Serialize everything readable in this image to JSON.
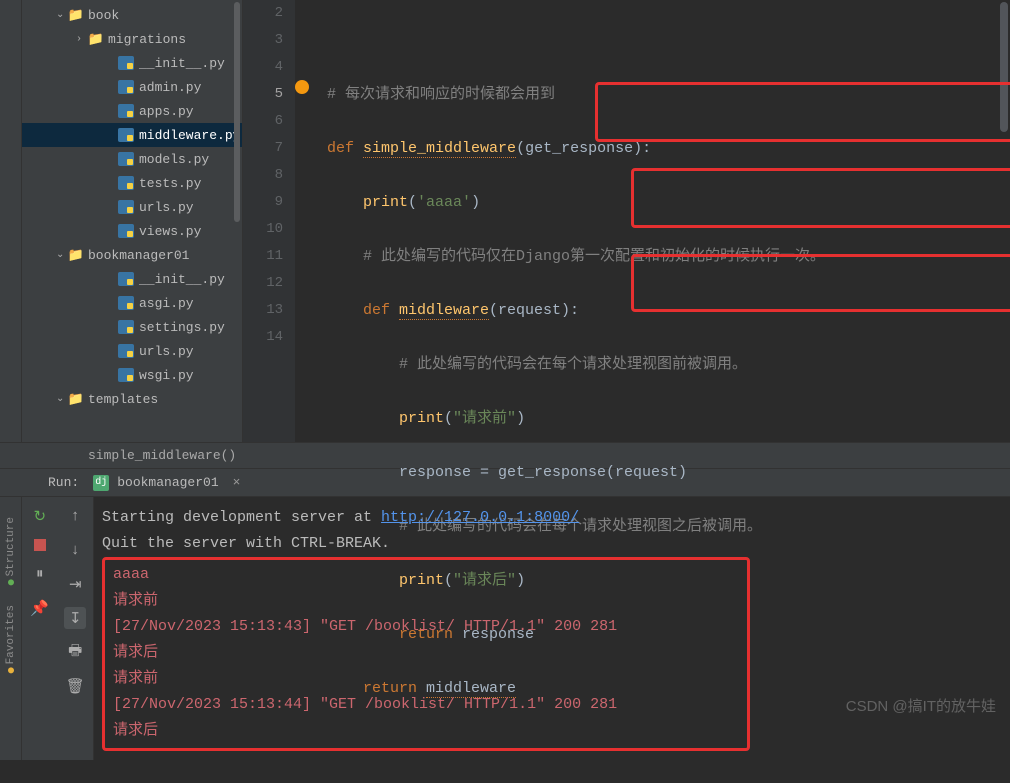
{
  "tree": {
    "items": [
      {
        "label": "book",
        "type": "folder",
        "expanded": true,
        "level": 1
      },
      {
        "label": "migrations",
        "type": "folder",
        "expanded": false,
        "level": 2
      },
      {
        "label": "__init__.py",
        "type": "py",
        "level": 3
      },
      {
        "label": "admin.py",
        "type": "py",
        "level": 3
      },
      {
        "label": "apps.py",
        "type": "py",
        "level": 3
      },
      {
        "label": "middleware.py",
        "type": "py",
        "level": 3,
        "selected": true
      },
      {
        "label": "models.py",
        "type": "py",
        "level": 3
      },
      {
        "label": "tests.py",
        "type": "py",
        "level": 3
      },
      {
        "label": "urls.py",
        "type": "py",
        "level": 3
      },
      {
        "label": "views.py",
        "type": "py",
        "level": 3
      },
      {
        "label": "bookmanager01",
        "type": "folder",
        "expanded": true,
        "level": 1
      },
      {
        "label": "__init__.py",
        "type": "py",
        "level": 3
      },
      {
        "label": "asgi.py",
        "type": "py",
        "level": 3
      },
      {
        "label": "settings.py",
        "type": "py",
        "level": 3
      },
      {
        "label": "urls.py",
        "type": "py",
        "level": 3
      },
      {
        "label": "wsgi.py",
        "type": "py",
        "level": 3
      },
      {
        "label": "templates",
        "type": "folder",
        "expanded": true,
        "level": 1
      }
    ]
  },
  "editor": {
    "line_numbers": [
      "2",
      "3",
      "4",
      "5",
      "6",
      "7",
      "8",
      "9",
      "10",
      "11",
      "12",
      "13",
      "14"
    ],
    "current_line": 5,
    "code": {
      "l3_cmt": "# 每次请求和响应的时候都会用到",
      "l4_def": "def ",
      "l4_fn": "simple_middleware",
      "l4_par": "(get_response):",
      "l5_print": "print",
      "l5_str": "'aaaa'",
      "l6_cmt": "# 此处编写的代码仅在Django第一次配置和初始化的时候执行一次。",
      "l7_def": "def ",
      "l7_fn": "middleware",
      "l7_par": "(request):",
      "l8_cmt": "# 此处编写的代码会在每个请求处理视图前被调用。",
      "l9_print": "print",
      "l9_str": "\"请求前\"",
      "l10": "response = get_response(request)",
      "l11_cmt": "# 此处编写的代码会在每个请求处理视图之后被调用。",
      "l12_print": "print",
      "l12_str": "\"请求后\"",
      "l13_ret": "return ",
      "l13_v": "response",
      "l14_ret": "return ",
      "l14_v": "middleware"
    },
    "breadcrumb": "simple_middleware()"
  },
  "run": {
    "label": "Run:",
    "config_icon": "dj",
    "config": "bookmanager01",
    "vtabs": {
      "structure": "Structure",
      "favorites": "Favorites"
    }
  },
  "console": {
    "line1a": "Starting development server at ",
    "line1_link": "http://127.0.0.1:8000/",
    "line2": "Quit the server with CTRL-BREAK.",
    "out": [
      "aaaa",
      "请求前",
      "[27/Nov/2023 15:13:43] \"GET /booklist/ HTTP/1.1\" 200 281",
      "请求后",
      "请求前",
      "[27/Nov/2023 15:13:44] \"GET /booklist/ HTTP/1.1\" 200 281",
      "请求后"
    ]
  },
  "watermark": "CSDN @搞IT的放牛娃"
}
